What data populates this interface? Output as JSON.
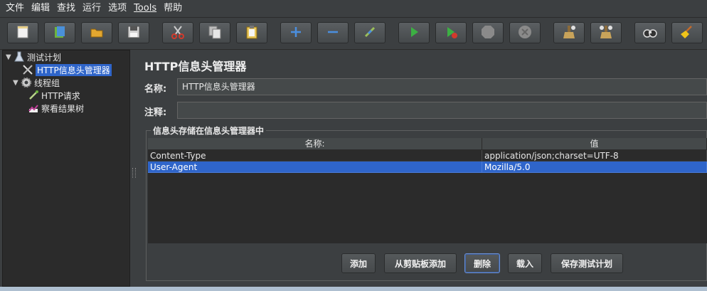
{
  "menu": [
    "文件",
    "编辑",
    "查找",
    "运行",
    "选项",
    "Tools",
    "帮助"
  ],
  "toolbar": {
    "buttons": [
      {
        "name": "new-icon",
        "color": "#f2f2f2"
      },
      {
        "name": "templates-icon",
        "color": "#6db33f"
      },
      {
        "name": "open-icon",
        "color": "#e3a72f"
      },
      {
        "name": "save-icon",
        "color": "#d0d0d0"
      },
      {
        "name": "cut-icon",
        "color": "#d33a2c"
      },
      {
        "name": "copy-icon",
        "color": "#dcdcdc"
      },
      {
        "name": "paste-icon",
        "color": "#e8c65a"
      },
      {
        "name": "expand-icon",
        "color": "#4a8fe0"
      },
      {
        "name": "collapse-icon",
        "color": "#4a8fe0"
      },
      {
        "name": "toggle-icon",
        "color": "#9bbf5a"
      },
      {
        "name": "start-icon",
        "color": "#3cb043"
      },
      {
        "name": "start-no-pauses-icon",
        "color": "#3cb043"
      },
      {
        "name": "stop-icon",
        "color": "#8a8a8a"
      },
      {
        "name": "shutdown-icon",
        "color": "#8a8a8a"
      },
      {
        "name": "clear-icon",
        "color": "#c8a35a"
      },
      {
        "name": "clear-all-icon",
        "color": "#c8a35a"
      },
      {
        "name": "search-icon",
        "color": "#d0d0d0"
      },
      {
        "name": "reset-search-icon",
        "color": "#f0c419"
      }
    ]
  },
  "tree": {
    "root": "测试计划",
    "header_manager": "HTTP信息头管理器",
    "thread_group": "线程组",
    "http_request": "HTTP请求",
    "results_tree": "察看结果树"
  },
  "panel": {
    "title": "HTTP信息头管理器",
    "name_label": "名称:",
    "name_value": "HTTP信息头管理器",
    "comment_label": "注释:",
    "comment_value": "",
    "group_title": "信息头存储在信息头管理器中",
    "columns": [
      "名称:",
      "值"
    ],
    "rows": [
      {
        "name": "Content-Type",
        "value": "application/json;charset=UTF-8"
      },
      {
        "name": "User-Agent",
        "value": "Mozilla/5.0"
      }
    ],
    "buttons": {
      "add": "添加",
      "add_clipboard": "从剪贴板添加",
      "delete": "删除",
      "load": "载入",
      "save_plan": "保存测试计划"
    }
  },
  "colors": {
    "selection": "#2f65ca",
    "background": "#3c3f41",
    "tree_bg": "#2b2b2b"
  }
}
